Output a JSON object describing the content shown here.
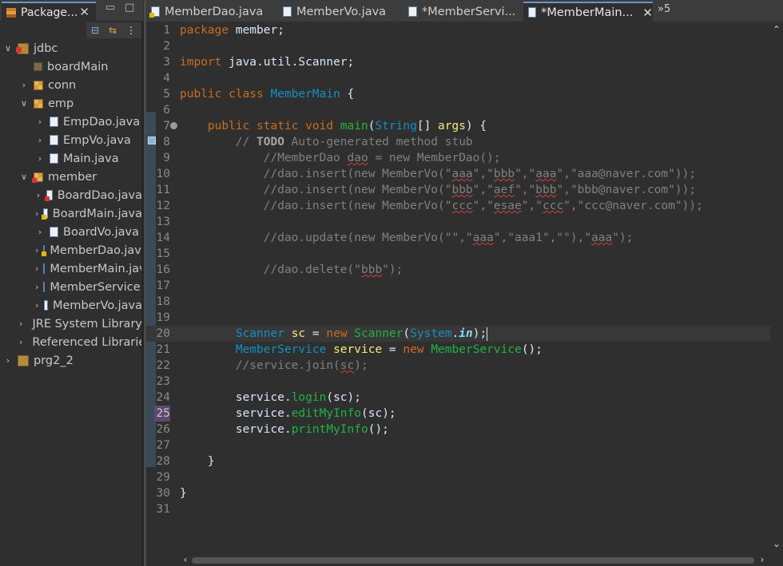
{
  "explorer": {
    "tab_title": "Package Explorer",
    "tab_title_visible": "Package...",
    "close_glyph": "✕",
    "minimize_glyph": "▭",
    "maximize_glyph": "□",
    "toolbar": {
      "collapse_all": "⊟",
      "link_editor": "⇆",
      "view_menu": "⋮"
    },
    "tree": [
      {
        "label": "jdbc",
        "icon": "project-error",
        "chevron": "∨",
        "indent": 0
      },
      {
        "label": "boardMain",
        "icon": "package-empty",
        "chevron": "",
        "indent": 1
      },
      {
        "label": "conn",
        "icon": "package",
        "chevron": "›",
        "indent": 1
      },
      {
        "label": "emp",
        "icon": "package",
        "chevron": "∨",
        "indent": 1
      },
      {
        "label": "EmpDao.java",
        "icon": "java-file",
        "chevron": "›",
        "indent": 2
      },
      {
        "label": "EmpVo.java",
        "icon": "java-file",
        "chevron": "›",
        "indent": 2
      },
      {
        "label": "Main.java",
        "icon": "java-file",
        "chevron": "›",
        "indent": 2
      },
      {
        "label": "member",
        "icon": "package-error",
        "chevron": "∨",
        "indent": 1
      },
      {
        "label": "BoardDao.java",
        "icon": "java-file-error",
        "chevron": "›",
        "indent": 2
      },
      {
        "label": "BoardMain.java",
        "icon": "java-file-warning",
        "chevron": "›",
        "indent": 2
      },
      {
        "label": "BoardVo.java",
        "icon": "java-file",
        "chevron": "›",
        "indent": 2
      },
      {
        "label": "MemberDao.java",
        "icon": "java-file-warning",
        "chevron": "›",
        "indent": 2
      },
      {
        "label": "MemberMain.java",
        "icon": "java-file",
        "chevron": "›",
        "indent": 2
      },
      {
        "label": "MemberService.java",
        "icon": "java-file",
        "chevron": "›",
        "indent": 2
      },
      {
        "label": "MemberVo.java",
        "icon": "java-file",
        "chevron": "›",
        "indent": 2
      },
      {
        "label": "JRE System Library",
        "icon": "library",
        "chevron": "›",
        "indent": 1
      },
      {
        "label": "Referenced Libraries",
        "icon": "library",
        "chevron": "›",
        "indent": 1
      },
      {
        "label": "prg2_2",
        "icon": "project",
        "chevron": "›",
        "indent": 0
      }
    ]
  },
  "editor_tabs": {
    "tabs": [
      {
        "label": "MemberDao.java",
        "icon": "java-file-warning",
        "active": false
      },
      {
        "label": "MemberVo.java",
        "icon": "java-file",
        "active": false
      },
      {
        "label": "*MemberServi...",
        "icon": "java-file",
        "active": false
      },
      {
        "label": "*MemberMain...",
        "icon": "java-file",
        "active": true
      }
    ],
    "close_glyph": "✕",
    "overflow_label": "»5"
  },
  "editor": {
    "line_numbers": [
      "1",
      "2",
      "3",
      "4",
      "5",
      "6",
      "7",
      "8",
      "9",
      "10",
      "11",
      "12",
      "13",
      "14",
      "15",
      "16",
      "17",
      "18",
      "19",
      "20",
      "21",
      "22",
      "23",
      "24",
      "25",
      "26",
      "27",
      "28",
      "29",
      "30",
      "31"
    ],
    "current_line": 20,
    "marked_line": 25,
    "folded_line": 7,
    "code_lines": [
      [
        {
          "t": "package",
          "c": "kw"
        },
        {
          "t": " member;",
          "c": "pl"
        }
      ],
      [],
      [
        {
          "t": "import",
          "c": "kw"
        },
        {
          "t": " java.util.Scanner;",
          "c": "pl"
        }
      ],
      [],
      [
        {
          "t": "public class",
          "c": "kw"
        },
        {
          "t": " ",
          "c": "pl"
        },
        {
          "t": "MemberMain",
          "c": "cl"
        },
        {
          "t": " {",
          "c": "pl"
        }
      ],
      [],
      [
        {
          "t": "    ",
          "c": "pl"
        },
        {
          "t": "public static void",
          "c": "kw"
        },
        {
          "t": " ",
          "c": "pl"
        },
        {
          "t": "main",
          "c": "mt"
        },
        {
          "t": "(",
          "c": "pl"
        },
        {
          "t": "String",
          "c": "cl"
        },
        {
          "t": "[] ",
          "c": "pl"
        },
        {
          "t": "args",
          "c": "vr"
        },
        {
          "t": ") {",
          "c": "pl"
        }
      ],
      [
        {
          "t": "        // ",
          "c": "cm"
        },
        {
          "t": "TODO",
          "c": "todo"
        },
        {
          "t": " Auto-generated method stub",
          "c": "cm"
        }
      ],
      [
        {
          "t": "            //MemberDao ",
          "c": "cm"
        },
        {
          "t": "dao",
          "c": "cm sq"
        },
        {
          "t": " = new MemberDao();",
          "c": "cm"
        }
      ],
      [
        {
          "t": "            //dao.insert(new MemberVo(\"",
          "c": "cm"
        },
        {
          "t": "aaa",
          "c": "cm sq"
        },
        {
          "t": "\",\"",
          "c": "cm"
        },
        {
          "t": "bbb",
          "c": "cm sq"
        },
        {
          "t": "\",\"",
          "c": "cm"
        },
        {
          "t": "aaa",
          "c": "cm sq"
        },
        {
          "t": "\",\"aaa@naver.com\"));",
          "c": "cm"
        }
      ],
      [
        {
          "t": "            //dao.insert(new MemberVo(\"",
          "c": "cm"
        },
        {
          "t": "bbb",
          "c": "cm sq"
        },
        {
          "t": "\",\"",
          "c": "cm"
        },
        {
          "t": "aef",
          "c": "cm sq"
        },
        {
          "t": "\",\"",
          "c": "cm"
        },
        {
          "t": "bbb",
          "c": "cm sq"
        },
        {
          "t": "\",\"bbb@naver.com\"));",
          "c": "cm"
        }
      ],
      [
        {
          "t": "            //dao.insert(new MemberVo(\"",
          "c": "cm"
        },
        {
          "t": "ccc",
          "c": "cm sq"
        },
        {
          "t": "\",\"",
          "c": "cm"
        },
        {
          "t": "esae",
          "c": "cm sq"
        },
        {
          "t": "\",\"",
          "c": "cm"
        },
        {
          "t": "ccc",
          "c": "cm sq"
        },
        {
          "t": "\",\"ccc@naver.com\"));",
          "c": "cm"
        }
      ],
      [],
      [
        {
          "t": "            //dao.update(new MemberVo(\"\",\"",
          "c": "cm"
        },
        {
          "t": "aaa",
          "c": "cm sq"
        },
        {
          "t": "\",\"aaa1\",\"\"),\"",
          "c": "cm"
        },
        {
          "t": "aaa",
          "c": "cm sq"
        },
        {
          "t": "\");",
          "c": "cm"
        }
      ],
      [],
      [
        {
          "t": "            //dao.delete(\"",
          "c": "cm"
        },
        {
          "t": "bbb",
          "c": "cm sq"
        },
        {
          "t": "\");",
          "c": "cm"
        }
      ],
      [],
      [],
      [],
      [
        {
          "t": "        ",
          "c": "pl"
        },
        {
          "t": "Scanner",
          "c": "cl"
        },
        {
          "t": " ",
          "c": "pl"
        },
        {
          "t": "sc",
          "c": "vr"
        },
        {
          "t": " = ",
          "c": "pl"
        },
        {
          "t": "new",
          "c": "kw"
        },
        {
          "t": " ",
          "c": "pl"
        },
        {
          "t": "Scanner",
          "c": "mt"
        },
        {
          "t": "(",
          "c": "pl"
        },
        {
          "t": "System",
          "c": "cl"
        },
        {
          "t": ".",
          "c": "pl"
        },
        {
          "t": "in",
          "c": "fi"
        },
        {
          "t": ");",
          "c": "pl"
        },
        {
          "t": "|",
          "c": "caret"
        }
      ],
      [
        {
          "t": "        ",
          "c": "pl"
        },
        {
          "t": "MemberService",
          "c": "cl"
        },
        {
          "t": " ",
          "c": "pl"
        },
        {
          "t": "service",
          "c": "vr"
        },
        {
          "t": " = ",
          "c": "pl"
        },
        {
          "t": "new",
          "c": "kw"
        },
        {
          "t": " ",
          "c": "pl"
        },
        {
          "t": "MemberService",
          "c": "mt"
        },
        {
          "t": "();",
          "c": "pl"
        }
      ],
      [
        {
          "t": "        //service.join(",
          "c": "cm"
        },
        {
          "t": "sc",
          "c": "cm sq"
        },
        {
          "t": ");",
          "c": "cm"
        }
      ],
      [],
      [
        {
          "t": "        service.",
          "c": "pl"
        },
        {
          "t": "login",
          "c": "mt"
        },
        {
          "t": "(sc);",
          "c": "pl"
        }
      ],
      [
        {
          "t": "        service.",
          "c": "pl"
        },
        {
          "t": "editMyInfo",
          "c": "mt"
        },
        {
          "t": "(sc);",
          "c": "pl"
        }
      ],
      [
        {
          "t": "        service.",
          "c": "pl"
        },
        {
          "t": "printMyInfo",
          "c": "mt"
        },
        {
          "t": "();",
          "c": "pl"
        }
      ],
      [],
      [
        {
          "t": "    }",
          "c": "pl"
        }
      ],
      [],
      [
        {
          "t": "}",
          "c": "pl"
        }
      ],
      []
    ]
  },
  "scroll": {
    "up": "⌃",
    "down": "⌄",
    "left": "‹",
    "right": "›"
  }
}
